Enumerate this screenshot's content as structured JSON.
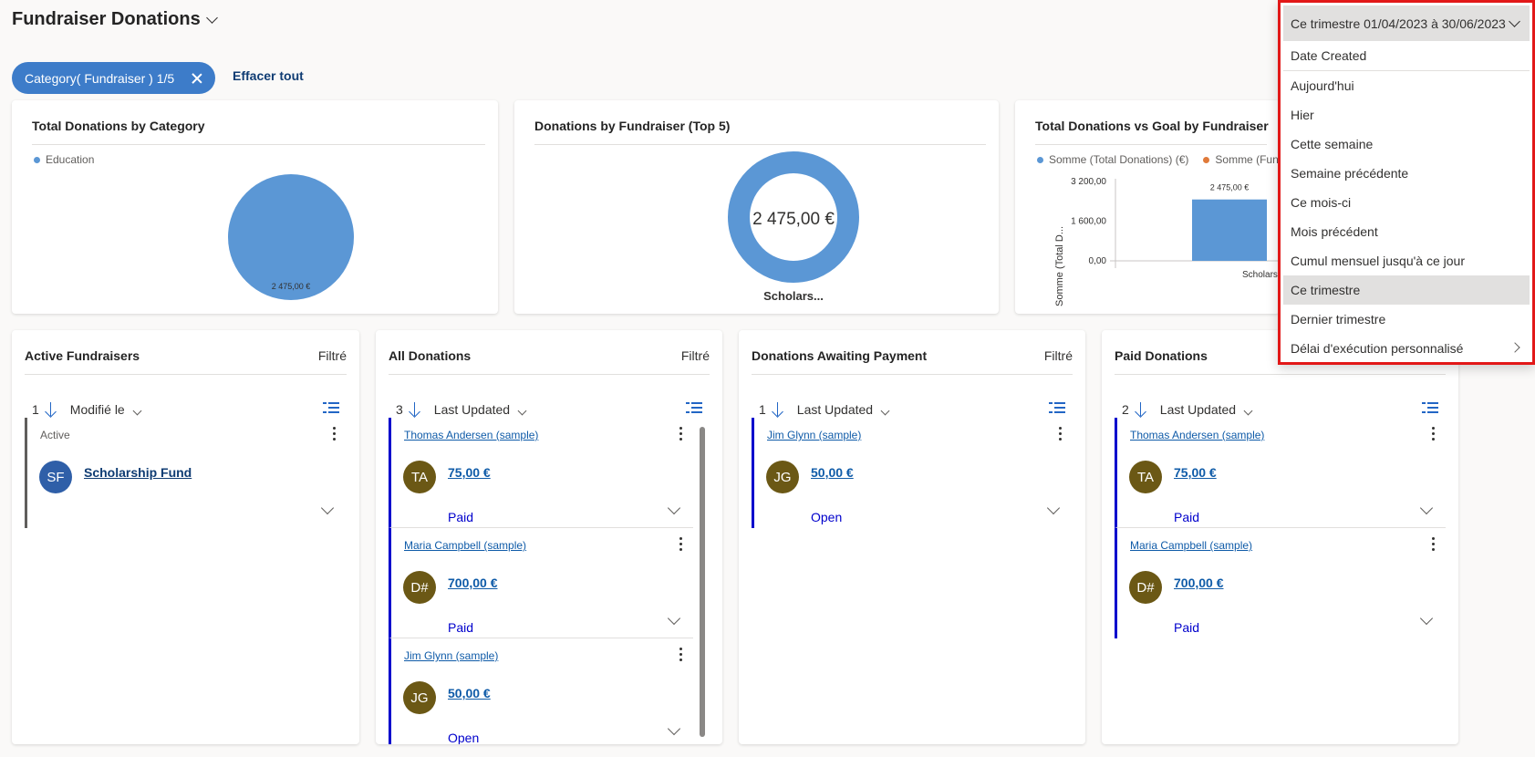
{
  "page": {
    "title": "Fundraiser Donations"
  },
  "filters": {
    "pill_label": "Category( Fundraiser ) 1/5",
    "clear_all": "Effacer tout"
  },
  "charts": {
    "category": {
      "title": "Total Donations by Category",
      "legend": "Education",
      "slice_label": "2 475,00 €"
    },
    "fundraiser": {
      "title": "Donations by Fundraiser (Top 5)",
      "center_label": "2 475,00 €",
      "bottom_label": "Scholars..."
    },
    "goal": {
      "title": "Total Donations vs Goal by Fundraiser",
      "legend1": "Somme (Total Donations) (€)",
      "legend2": "Somme (Func",
      "ylabel": "Somme (Total D...",
      "ticks": [
        "3 200,00",
        "1 600,00",
        "0,00"
      ],
      "bar_label": "2 475,00 €",
      "x_label": "Scholars"
    }
  },
  "chart_data": [
    {
      "type": "pie",
      "title": "Total Donations by Category",
      "categories": [
        "Education"
      ],
      "values": [
        2475
      ],
      "legend": "top-left"
    },
    {
      "type": "pie",
      "title": "Donations by Fundraiser (Top 5)",
      "categories": [
        "Scholars..."
      ],
      "values": [
        2475
      ]
    },
    {
      "type": "bar",
      "title": "Total Donations vs Goal by Fundraiser",
      "categories": [
        "Scholars"
      ],
      "series": [
        {
          "name": "Somme (Total Donations) (€)",
          "values": [
            2475
          ]
        }
      ],
      "ylabel": "Somme (Total D...",
      "ylim": [
        0,
        3200
      ],
      "ticks": [
        0,
        1600,
        3200
      ]
    }
  ],
  "lists": {
    "active": {
      "title": "Active Fundraisers",
      "filtered": "Filtré",
      "count": "1",
      "sort": "Modifié le",
      "records": [
        {
          "status": "Active",
          "initials": "SF",
          "name": "Scholarship Fund"
        }
      ]
    },
    "all": {
      "title": "All Donations",
      "filtered": "Filtré",
      "count": "3",
      "sort": "Last Updated",
      "records": [
        {
          "name": "Thomas Andersen (sample)",
          "initials": "TA",
          "amount": "75,00 €",
          "status": "Paid"
        },
        {
          "name": "Maria Campbell (sample)",
          "initials": "D#",
          "amount": "700,00 €",
          "status": "Paid"
        },
        {
          "name": "Jim Glynn (sample)",
          "initials": "JG",
          "amount": "50,00 €",
          "status": "Open"
        }
      ]
    },
    "awaiting": {
      "title": "Donations Awaiting Payment",
      "filtered": "Filtré",
      "count": "1",
      "sort": "Last Updated",
      "records": [
        {
          "name": "Jim Glynn (sample)",
          "initials": "JG",
          "amount": "50,00 €",
          "status": "Open"
        }
      ]
    },
    "paid": {
      "title": "Paid Donations",
      "count": "2",
      "sort": "Last Updated",
      "records": [
        {
          "name": "Thomas Andersen (sample)",
          "initials": "TA",
          "amount": "75,00 €",
          "status": "Paid"
        },
        {
          "name": "Maria Campbell (sample)",
          "initials": "D#",
          "amount": "700,00 €",
          "status": "Paid"
        }
      ]
    }
  },
  "date_dropdown": {
    "current": "Ce trimestre 01/04/2023 à 30/06/2023",
    "header": "Date Created",
    "items": [
      "Aujourd'hui",
      "Hier",
      "Cette semaine",
      "Semaine précédente",
      "Ce mois-ci",
      "Mois précédent",
      "Cumul mensuel jusqu'à ce jour",
      "Ce trimestre",
      "Dernier trimestre",
      "Délai d'exécution personnalisé"
    ],
    "selected_index": 7
  },
  "colors": {
    "accent": "#3d7cc9",
    "chart_blue": "#5b97d5",
    "chart_orange": "#e07a3a",
    "record_border": "#0000cc",
    "highlight": "#e21818"
  }
}
